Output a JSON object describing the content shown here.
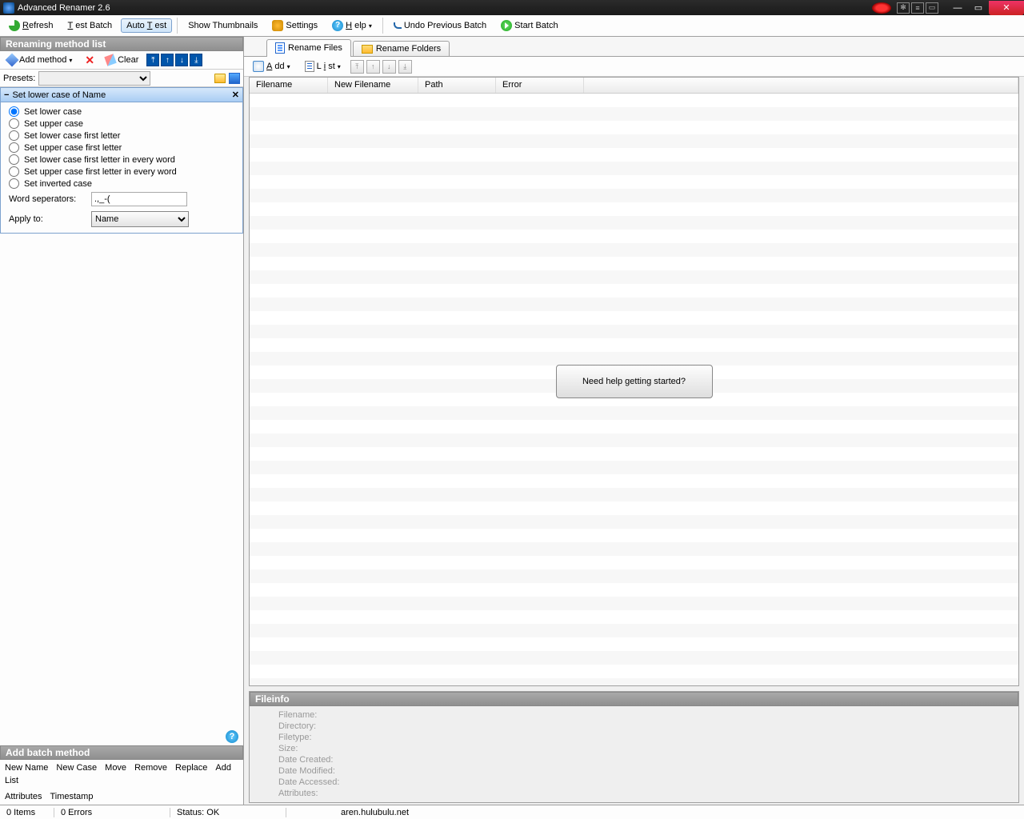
{
  "title": "Advanced Renamer 2.6",
  "toolbar": {
    "refresh": "Refresh",
    "test_batch": "Test Batch",
    "auto_test": "Auto Test",
    "show_thumbnails": "Show Thumbnails",
    "settings": "Settings",
    "help": "Help",
    "undo": "Undo Previous Batch",
    "start": "Start Batch"
  },
  "left": {
    "method_list_title": "Renaming method list",
    "add_method": "Add method",
    "clear": "Clear",
    "presets_label": "Presets:",
    "method": {
      "title": "Set lower case of Name",
      "options": [
        "Set lower case",
        "Set upper case",
        "Set lower case first letter",
        "Set upper case first letter",
        "Set lower case first letter in every word",
        "Set upper case first letter in every word",
        "Set inverted case"
      ],
      "selected_index": 0,
      "word_sep_label": "Word seperators:",
      "word_sep_value": ".,_-(",
      "apply_to_label": "Apply to:",
      "apply_to_value": "Name"
    },
    "batch": {
      "title": "Add batch method",
      "items": [
        "New Name",
        "New Case",
        "Move",
        "Remove",
        "Replace",
        "Add",
        "List",
        "Attributes",
        "Timestamp"
      ]
    }
  },
  "right": {
    "tabs": {
      "files": "Rename Files",
      "folders": "Rename Folders"
    },
    "file_toolbar": {
      "add": "Add",
      "list": "List"
    },
    "columns": [
      "Filename",
      "New Filename",
      "Path",
      "Error"
    ],
    "help_prompt": "Need help getting started?",
    "fileinfo": {
      "title": "Fileinfo",
      "rows": [
        "Filename:",
        "Directory:",
        "Filetype:",
        "Size:",
        "Date Created:",
        "Date Modified:",
        "Date Accessed:",
        "Attributes:"
      ]
    }
  },
  "status": {
    "items": "0 Items",
    "errors": "0 Errors",
    "status": "Status: OK",
    "url": "aren.hulubulu.net"
  }
}
